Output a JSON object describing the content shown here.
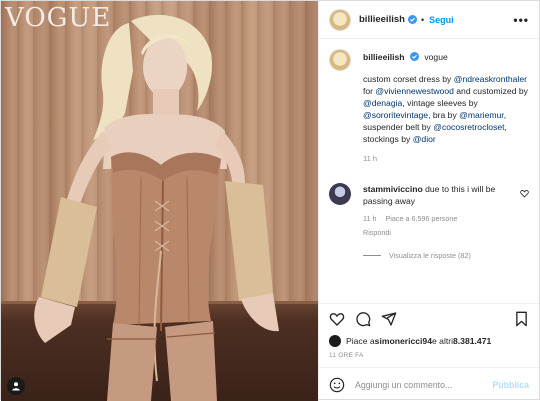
{
  "photo": {
    "logo_text": "VOGUE",
    "user_tag_icon": "person-icon"
  },
  "header": {
    "username": "billieeilish",
    "verified_icon": "verified-badge-icon",
    "separator": "•",
    "follow_label": "Segui",
    "more_icon": "more-horizontal-icon"
  },
  "caption": {
    "username": "billieeilish",
    "coauthor": "vogue",
    "parts": [
      {
        "text": "custom corset dress by ",
        "link": false
      },
      {
        "text": "@ndreaskronthaler",
        "link": true
      },
      {
        "text": " for ",
        "link": false
      },
      {
        "text": "@viviennewestwood",
        "link": true
      },
      {
        "text": " and customized by ",
        "link": false
      },
      {
        "text": "@denagia",
        "link": true
      },
      {
        "text": ", vintage sleeves by ",
        "link": false
      },
      {
        "text": "@sororitevintage",
        "link": true
      },
      {
        "text": ", bra by ",
        "link": false
      },
      {
        "text": "@mariemur",
        "link": true
      },
      {
        "text": ", suspender belt by ",
        "link": false
      },
      {
        "text": "@cocosretrocloset",
        "link": true
      },
      {
        "text": ", stockings by ",
        "link": false
      },
      {
        "text": "@dior",
        "link": true
      }
    ],
    "time": "11 h"
  },
  "comment": {
    "username": "stammiviccino",
    "text": "due to this i will be passing away",
    "time": "11 h",
    "likes": "Piace a 6.596 persone",
    "reply": "Rispondi",
    "view_replies": "Visualizza le risposte (82)"
  },
  "actions": {
    "like_icon": "heart-icon",
    "comment_icon": "comment-icon",
    "share_icon": "share-icon",
    "save_icon": "bookmark-icon"
  },
  "likes": {
    "prefix": "Piace a ",
    "user": "simonericci94",
    "middle": " e altri ",
    "count": "8.381.471"
  },
  "date": "11 ORE FA",
  "add_comment": {
    "emoji_icon": "emoji-icon",
    "placeholder": "Aggiungi un commento...",
    "publish_label": "Pubblica"
  },
  "colors": {
    "link": "#00376b",
    "follow": "#0095f6",
    "muted": "#8e8e8e",
    "publish_disabled": "#b2dffc"
  }
}
